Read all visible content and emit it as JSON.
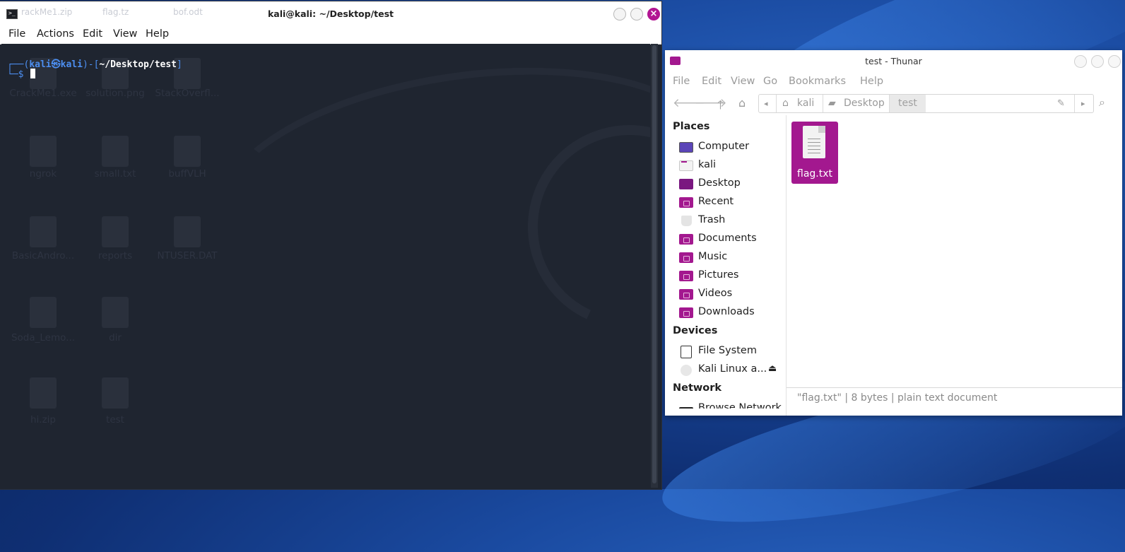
{
  "terminal": {
    "title": "kali@kali: ~/Desktop/test",
    "behind_labels": [
      "rackMe1.zip",
      "flag.tz",
      "bof.odt"
    ],
    "menu": [
      "File",
      "Actions",
      "Edit",
      "View",
      "Help"
    ],
    "prompt": {
      "line1_prefix": "┌──(",
      "user": "kali㉿kali",
      "mid": ")-[",
      "path": "~/Desktop/test",
      "suffix": "]",
      "line2": "└─$"
    },
    "ghost_icons": [
      "CrackMe1.exe",
      "solution.png",
      "StackOverfl...",
      "ngrok",
      "small.txt",
      "buffVLH",
      "BasicAndro...",
      "reports",
      "NTUSER.DAT",
      "Soda_Lemo...",
      "dir",
      "hi.zip",
      "test"
    ]
  },
  "thunar": {
    "title": "test - Thunar",
    "menu": [
      "File",
      "Edit",
      "View",
      "Go",
      "Bookmarks",
      "Help"
    ],
    "breadcrumbs": [
      "kali",
      "Desktop",
      "test"
    ],
    "sections": {
      "places": "Places",
      "devices": "Devices",
      "network": "Network"
    },
    "places": [
      {
        "label": "Computer",
        "icon": "computer-icon"
      },
      {
        "label": "kali",
        "icon": "home-folder-icon"
      },
      {
        "label": "Desktop",
        "icon": "desktop-folder-icon"
      },
      {
        "label": "Recent",
        "icon": "recent-folder-icon"
      },
      {
        "label": "Trash",
        "icon": "trash-icon"
      },
      {
        "label": "Documents",
        "icon": "documents-folder-icon"
      },
      {
        "label": "Music",
        "icon": "music-folder-icon"
      },
      {
        "label": "Pictures",
        "icon": "pictures-folder-icon"
      },
      {
        "label": "Videos",
        "icon": "videos-folder-icon"
      },
      {
        "label": "Downloads",
        "icon": "downloads-folder-icon"
      }
    ],
    "devices": [
      {
        "label": "File System",
        "icon": "disk-icon"
      },
      {
        "label": "Kali Linux a...",
        "icon": "optical-disc-icon"
      }
    ],
    "network": [
      {
        "label": "Browse Network",
        "icon": "network-icon"
      }
    ],
    "files": [
      {
        "name": "flag.txt"
      }
    ],
    "status": "\"flag.txt\"  |  8 bytes  |  plain text document"
  }
}
